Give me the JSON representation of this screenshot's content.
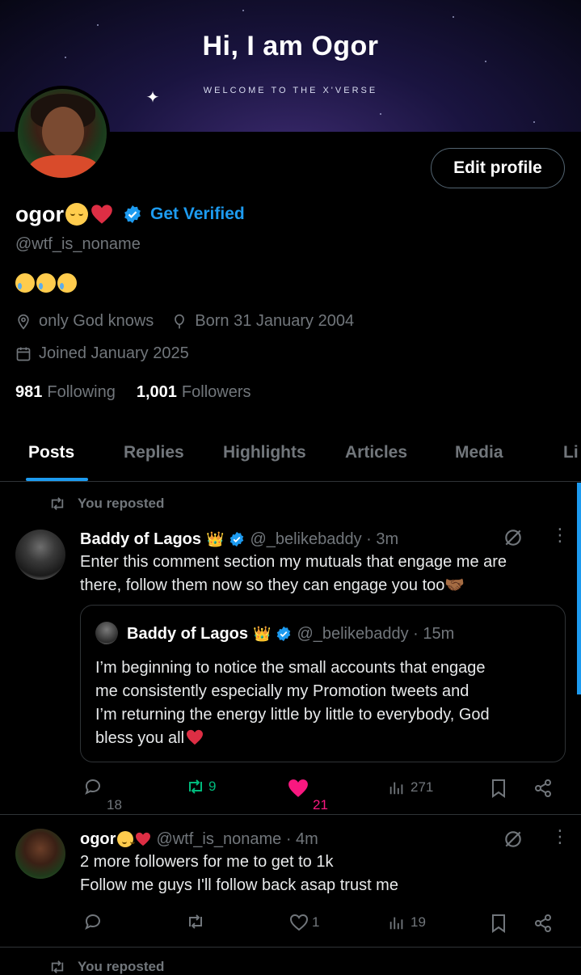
{
  "banner": {
    "title": "Hi, I am Ogor",
    "subtitle": "WELCOME TO THE X'VERSE"
  },
  "profile": {
    "edit_label": "Edit profile",
    "name": "ogor",
    "get_verified": "Get Verified",
    "handle": "@wtf_is_noname",
    "location": "only God knows",
    "birth": "Born 31 January 2004",
    "joined": "Joined January 2025",
    "following_count": "981",
    "following_label": "Following",
    "followers_count": "1,001",
    "followers_label": "Followers"
  },
  "tabs": [
    "Posts",
    "Replies",
    "Highlights",
    "Articles",
    "Media",
    "Li"
  ],
  "posts": [
    {
      "repost_label": "You reposted",
      "name": "Baddy of Lagos",
      "handle": "@_belikebaddy · 3m",
      "text_line1": "Enter this comment section my mutuals that engage me are",
      "text_line2": "there, follow them now so they can engage you too",
      "quote": {
        "name": "Baddy of Lagos",
        "handle": "@_belikebaddy · 15m",
        "line1": "I’m beginning to notice the small accounts that engage",
        "line2": "me consistently especially my Promotion tweets and",
        "line3": "I’m returning the energy little by little to everybody, God",
        "line4": "bless you all"
      },
      "replies": "18",
      "reposts": "9",
      "likes": "21",
      "views": "271"
    },
    {
      "name": "ogor",
      "handle": "@wtf_is_noname · 4m",
      "text_line1": "2 more followers for me to get to 1k",
      "text_line2": "Follow me guys I'll follow back asap trust me",
      "likes": "1",
      "views": "19"
    }
  ],
  "next_repost_label": "You reposted",
  "colors": {
    "accent": "#1d9bf0",
    "like": "#f91880",
    "repost": "#00ba7c",
    "muted": "#71767b"
  }
}
